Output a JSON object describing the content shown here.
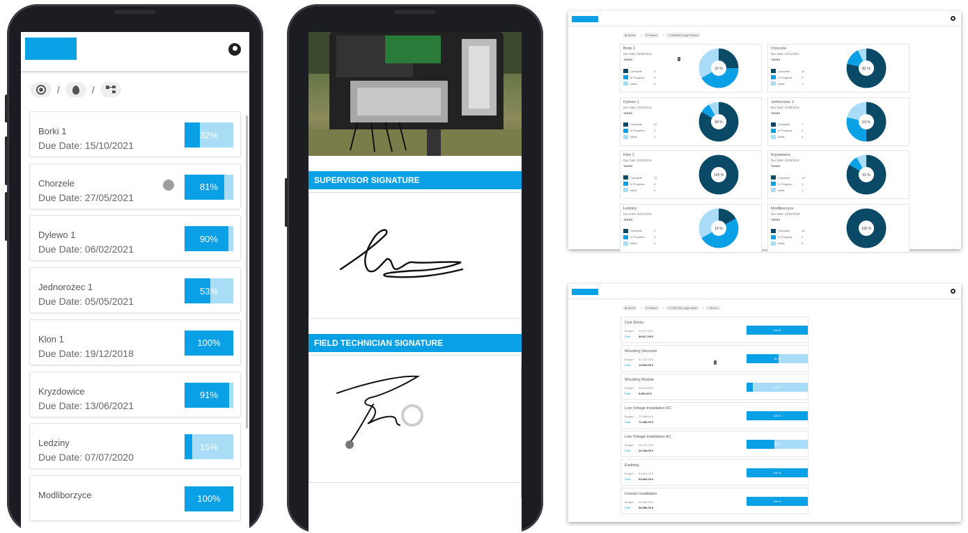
{
  "colors": {
    "accent": "#0aa0e6",
    "accent_light": "#a9dcf6",
    "dark": "#0b4a66"
  },
  "icons": {
    "account": "account-circle-icon",
    "globe": "globe-icon",
    "pin": "location-pin-icon",
    "tree": "hierarchy-icon"
  },
  "phone1": {
    "sites": [
      {
        "name": "Borki 1",
        "due": "Due Date: 15/10/2021",
        "percent": 32,
        "label": "32%"
      },
      {
        "name": "Chorzele",
        "due": "Due Date: 27/05/2021",
        "percent": 81,
        "label": "81%"
      },
      {
        "name": "Dylewo 1",
        "due": "Due Date: 06/02/2021",
        "percent": 90,
        "label": "90%"
      },
      {
        "name": "Jednorożec 1",
        "due": "Due Date: 05/05/2021",
        "percent": 53,
        "label": "53%"
      },
      {
        "name": "Klon 1",
        "due": "Due Date: 19/12/2018",
        "percent": 100,
        "label": "100%"
      },
      {
        "name": "Kryzdowice",
        "due": "Due Date: 13/06/2021",
        "percent": 91,
        "label": "91%"
      },
      {
        "name": "Ledziny",
        "due": "Due Date: 07/07/2020",
        "percent": 15,
        "label": "15%"
      },
      {
        "name": "Modliborzyce",
        "due": "",
        "percent": 100,
        "label": "100%"
      }
    ]
  },
  "phone2": {
    "supervisor_title": "SUPERVISOR SIGNATURE",
    "technician_title": "FIELD TECHNICIAN SIGNATURE"
  },
  "desktop1": {
    "crumbs": [
      "World",
      "Poland",
      "1880MW_large Poland"
    ],
    "tasks_label": "TASKS",
    "legend": {
      "complete": "Complete",
      "in_progress": "In Progress",
      "initial": "Initial"
    },
    "sites": [
      {
        "name": "Borki 1",
        "due": "Due Date: 05/02/2021",
        "complete": 3,
        "in_progress": 5,
        "initial": 4,
        "percent": 32,
        "label": "32 %"
      },
      {
        "name": "Chorzele",
        "due": "Due Date: 20/11/2021",
        "complete": 11,
        "in_progress": 2,
        "initial": 1,
        "percent": 81,
        "label": "81 %"
      },
      {
        "name": "Dylewo 1",
        "due": "Due Date: 29/10/2021",
        "complete": 10,
        "in_progress": 1,
        "initial": 1,
        "percent": 90,
        "label": "90 %"
      },
      {
        "name": "Jednorożec 1",
        "due": "Due Date: 20/08/2021",
        "complete": 7,
        "in_progress": 4,
        "initial": 3,
        "percent": 53,
        "label": "53 %"
      },
      {
        "name": "Klon 1",
        "due": "Due Date: 03/12/2018",
        "complete": 12,
        "in_progress": 0,
        "initial": 0,
        "percent": 100,
        "label": "100 %"
      },
      {
        "name": "Kryzdowice",
        "due": "Due Date: 08/05/2021",
        "complete": 10,
        "in_progress": 1,
        "initial": 1,
        "percent": 91,
        "label": "91 %"
      },
      {
        "name": "Ledziny",
        "due": "Due Date: 03/11/2021",
        "complete": 2,
        "in_progress": 6,
        "initial": 4,
        "percent": 15,
        "label": "15 %"
      },
      {
        "name": "Modliborzyce",
        "due": "Due Date: 24/02/2018",
        "complete": 14,
        "in_progress": 0,
        "initial": 0,
        "percent": 100,
        "label": "100 %"
      }
    ]
  },
  "desktop2": {
    "crumbs": [
      "World",
      "Poland",
      "1700 MW_large Solar",
      "Borki 1"
    ],
    "budget_label": "Budget",
    "paid_label": "Paid",
    "items": [
      {
        "name": "Civil Works",
        "budget": "39.917,00 €",
        "paid": "39.917,00 €",
        "percent": 100,
        "label": "100 %"
      },
      {
        "name": "Mounting Structure",
        "budget": "22.722,00 €",
        "paid": "13.863,00 €",
        "percent": 52,
        "label": "52 %"
      },
      {
        "name": "Mounting Module",
        "budget": "68.913,00 €",
        "paid": "6.891,00 €",
        "percent": 10,
        "label": "10 %"
      },
      {
        "name": "Low Voltage Installation DC",
        "budget": "71.386,00 €",
        "paid": "71.386,00 €",
        "percent": 100,
        "label": "100 %"
      },
      {
        "name": "Low Voltage Installation AC",
        "budget": "48.447,00 €",
        "paid": "20.448,00 €",
        "percent": 45,
        "label": "45 %"
      },
      {
        "name": "Earthing",
        "budget": "53.864,00 €",
        "paid": "53.864,00 €",
        "percent": 100,
        "label": "100 %"
      },
      {
        "name": "Inverter Installation",
        "budget": "56.580,00 €",
        "paid": "56.580,00 €",
        "percent": 100,
        "label": "100 %"
      }
    ]
  }
}
